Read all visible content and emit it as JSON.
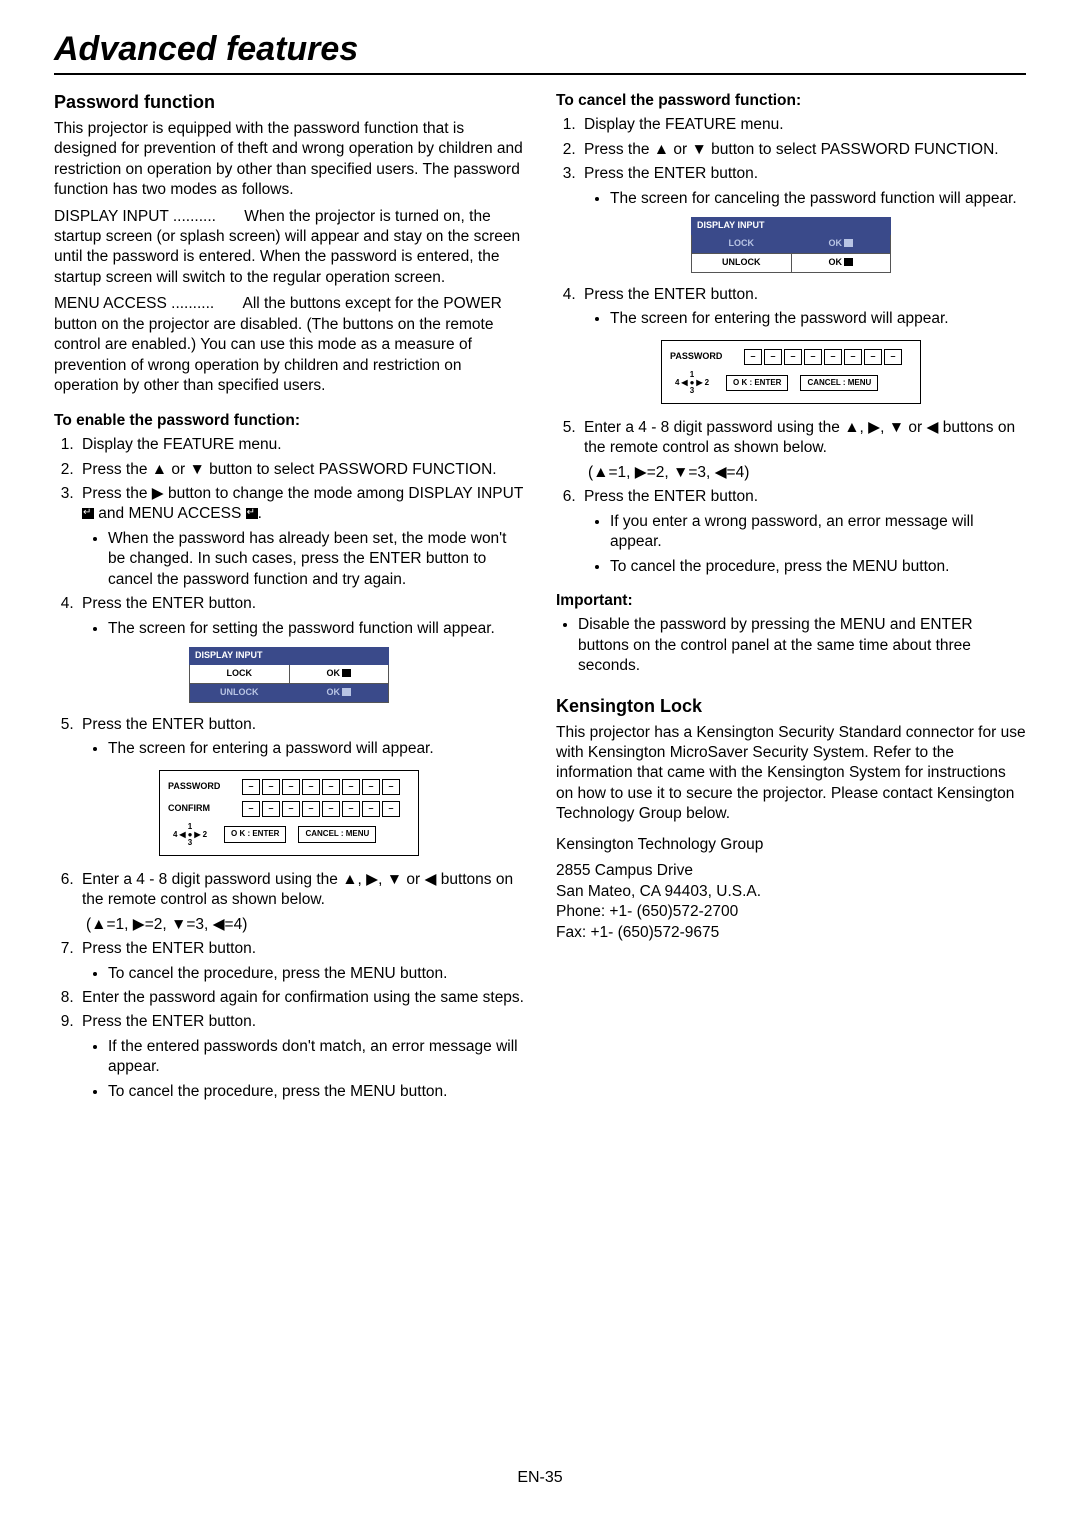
{
  "title": "Advanced features",
  "left": {
    "h1": "Password function",
    "intro": "This projector is equipped with the password function that is designed for prevention of theft and wrong operation by children and restriction on operation by other than specified users. The password function has two modes as follows.",
    "mode1_label": "DISPLAY INPUT ..........",
    "mode1_body": "When the projector is turned on, the startup screen (or splash screen) will appear and stay on the screen until the password is entered. When the password is entered, the startup screen will switch to the regular operation screen.",
    "mode2_label": "MENU ACCESS ..........",
    "mode2_body": "All the buttons except for the POWER button on the projector are disabled. (The buttons on the remote control are enabled.) You can use this mode as a measure of prevention of wrong operation by children and restriction on operation by other than specified users.",
    "enable_h": "To enable the password function:",
    "s1": "Display the FEATURE menu.",
    "s2a": "Press the ",
    "s2b": " or ",
    "s2c": " button to select PASSWORD FUNCTION.",
    "s3a": "Press the ",
    "s3b": " button to change the mode among DISPLAY INPUT ",
    "s3c": " and MENU ACCESS ",
    "s3d": ".",
    "s3_bullet": "When the password has already been set, the mode won't be changed. In such cases, press the ENTER button to cancel the password function and try again.",
    "s4": "Press the ENTER button.",
    "s4_bullet": "The screen for setting the password function will appear.",
    "osd1": {
      "hdr": "DISPLAY INPUT",
      "r1a": "LOCK",
      "r1b": "OK",
      "r2a": "UNLOCK",
      "r2b": "OK"
    },
    "s5": "Press the ENTER button.",
    "s5_bullet": "The screen for entering a password will appear.",
    "osd2": {
      "l1": "PASSWORD",
      "l2": "CONFIRM",
      "dpad": {
        "t": "1",
        "l": "4",
        "r": "2",
        "b": "3"
      },
      "btn1": "O K : ENTER",
      "btn2": "CANCEL : MENU",
      "dash": "–"
    },
    "s6a": "Enter a 4 - 8 digit password using the ",
    "s6b": ", ",
    "s6c": ", ",
    "s6d": " or ",
    "s6e": " buttons on the remote control as shown below.",
    "map": "(▲=1, ▶=2, ▼=3, ◀=4)",
    "s7": "Press the ENTER button.",
    "s7_bullet": "To cancel the procedure, press the MENU button.",
    "s8": "Enter the password again for confirmation using the same steps.",
    "s9": "Press the ENTER button.",
    "s9_b1": "If the entered passwords don't match, an error message will appear.",
    "s9_b2": "To cancel the procedure, press the MENU button."
  },
  "right": {
    "cancel_h": "To cancel the password function:",
    "s1": "Display the FEATURE menu.",
    "s2a": "Press the ",
    "s2b": " or ",
    "s2c": " button to select PASSWORD FUNCTION.",
    "s3": "Press the ENTER button.",
    "s3_bullet": "The screen for canceling the password function will appear.",
    "osd1": {
      "hdr": "DISPLAY INPUT",
      "r1a": "LOCK",
      "r1b": "OK",
      "r2a": "UNLOCK",
      "r2b": "OK"
    },
    "s4": "Press the ENTER button.",
    "s4_bullet": "The screen for entering the password will appear.",
    "osd2": {
      "l1": "PASSWORD",
      "dpad": {
        "t": "1",
        "l": "4",
        "r": "2",
        "b": "3"
      },
      "btn1": "O K : ENTER",
      "btn2": "CANCEL : MENU",
      "dash": "–"
    },
    "s5a": "Enter a 4 - 8 digit password using the ",
    "s5b": ", ",
    "s5c": ", ",
    "s5d": " or ",
    "s5e": " buttons on the remote control as shown below.",
    "map": "(▲=1, ▶=2, ▼=3, ◀=4)",
    "s6": "Press the ENTER button.",
    "s6_b1": "If you enter a wrong password, an error message will appear.",
    "s6_b2": "To cancel the procedure, press the MENU button.",
    "imp_h": "Important:",
    "imp_b": "Disable the password by pressing the MENU and ENTER buttons on the control panel at the same time about three seconds.",
    "kl_h": "Kensington Lock",
    "kl_p": "This projector has a Kensington Security Standard connector for use with Kensington MicroSaver Security System. Refer to the information that came with the Kensington System for instructions on how to use it to secure the projector. Please contact Kensington Technology Group below.",
    "addr1": "Kensington Technology Group",
    "addr2": "2855 Campus Drive",
    "addr3": "San Mateo, CA 94403, U.S.A.",
    "addr4": "Phone: +1- (650)572-2700",
    "addr5": "Fax: +1- (650)572-9675"
  },
  "footer": "EN-35",
  "glyphs": {
    "up": "▲",
    "down": "▼",
    "left": "◀",
    "right": "▶"
  }
}
